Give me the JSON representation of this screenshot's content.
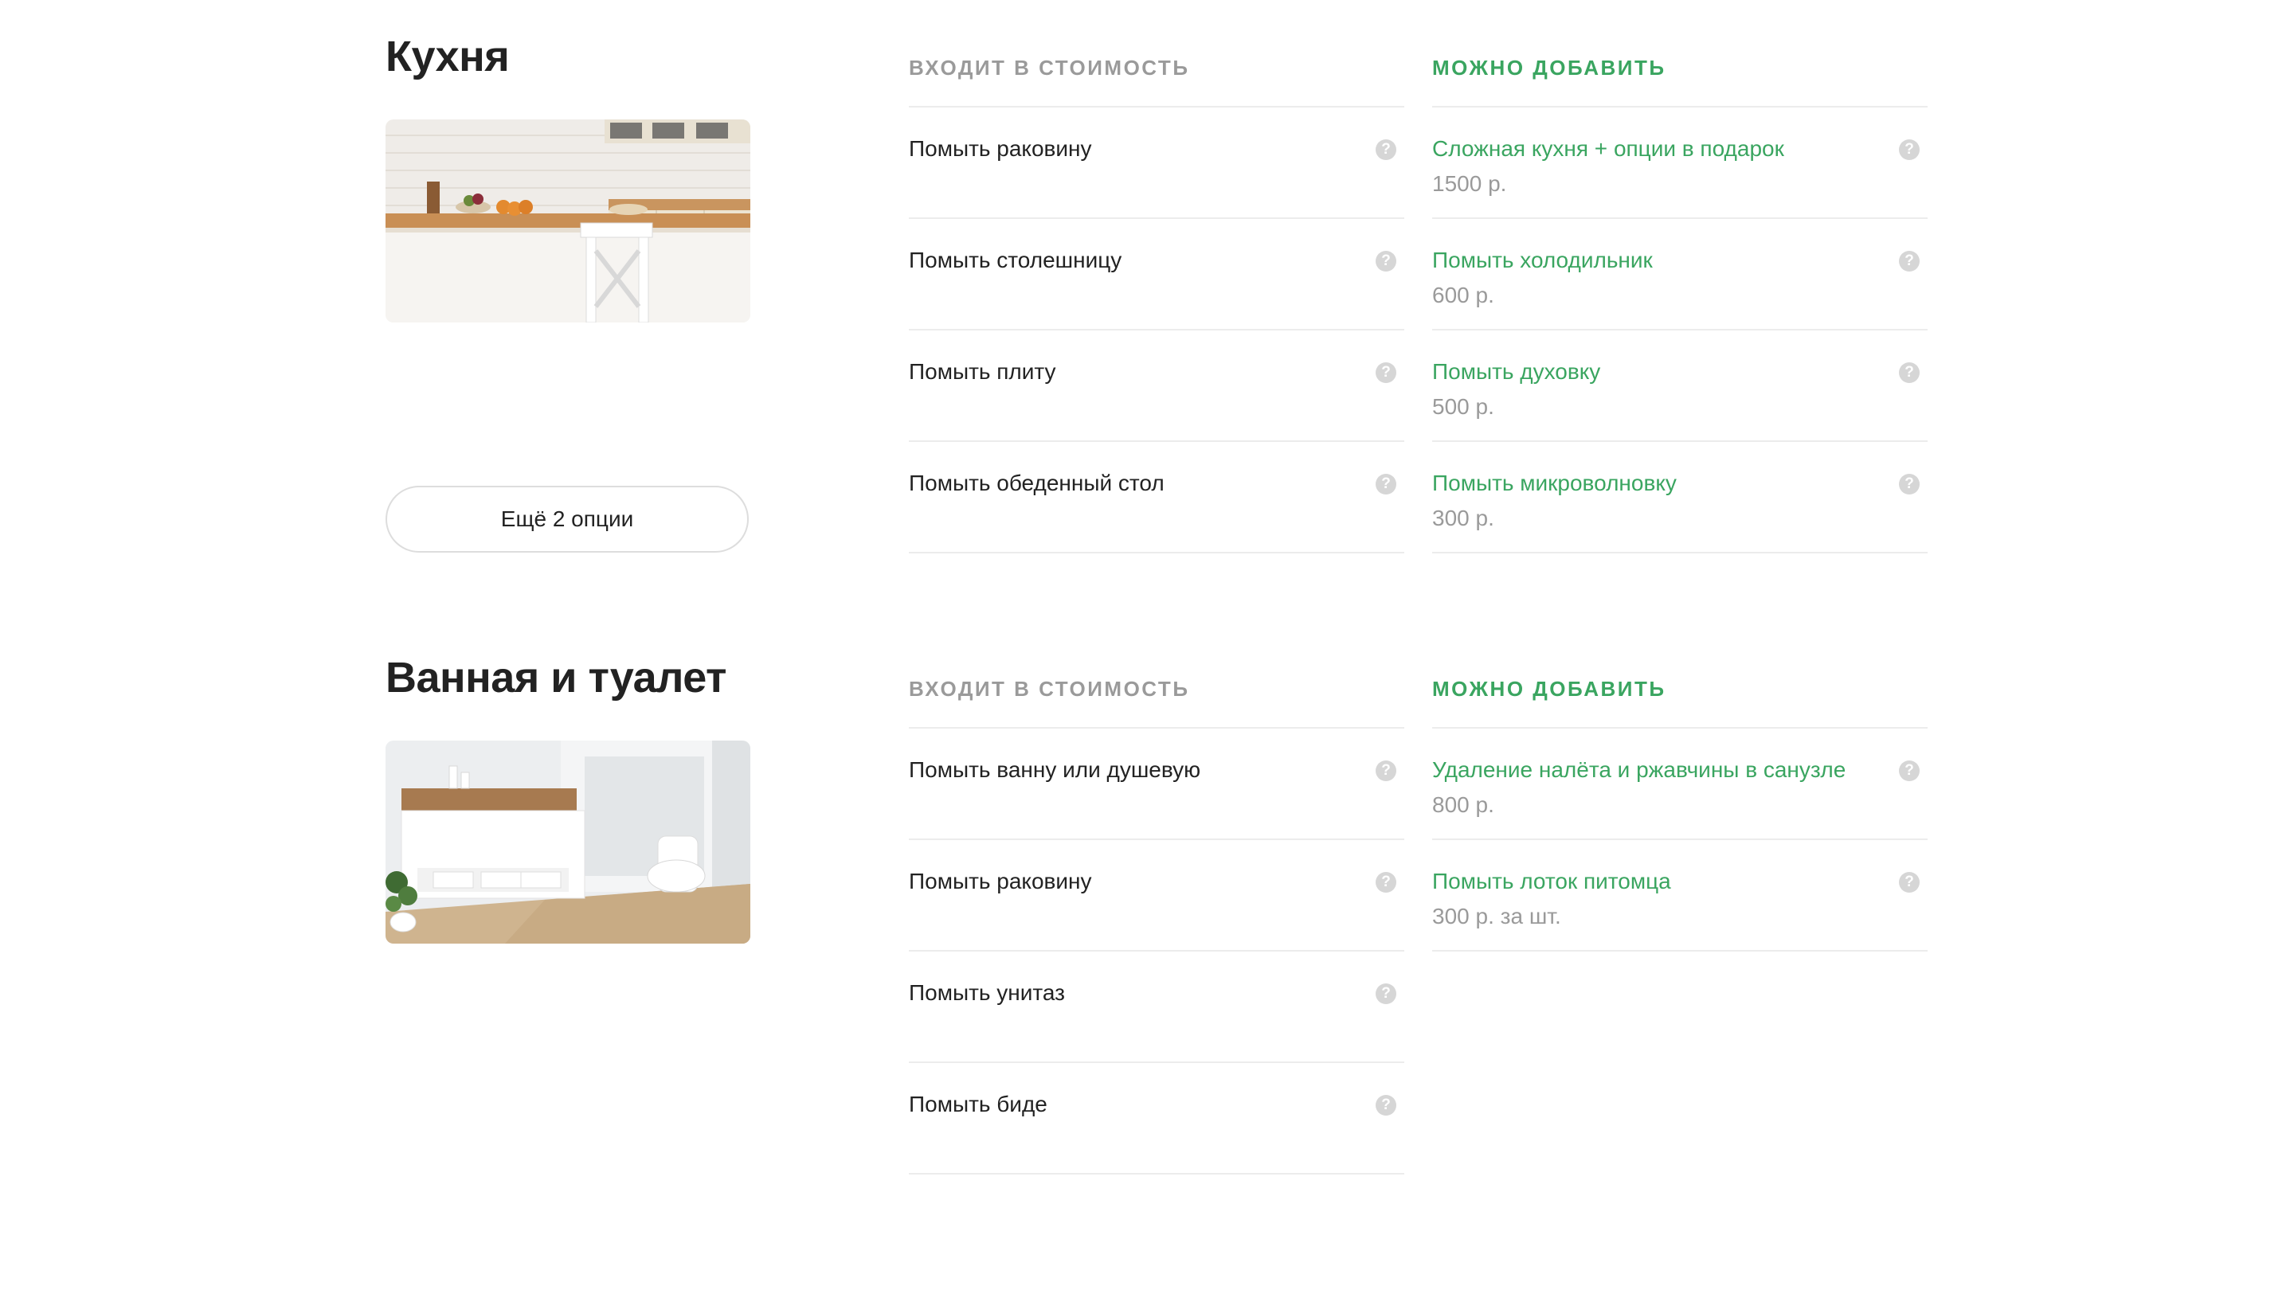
{
  "sections": [
    {
      "title": "Кухня",
      "image_icon": "kitchen-photo",
      "more_button": "Ещё 2 опции",
      "included_header": "Входит в стоимость",
      "addons_header": "Можно добавить",
      "included": [
        {
          "name": "Помыть раковину",
          "help": "?"
        },
        {
          "name": "Помыть столешницу",
          "help": "?"
        },
        {
          "name": "Помыть плиту",
          "help": "?"
        },
        {
          "name": "Помыть обеденный стол",
          "help": "?"
        }
      ],
      "addons": [
        {
          "name": "Сложная кухня + опции в подарок",
          "price": "1500 р.",
          "help": "?"
        },
        {
          "name": "Помыть холодильник",
          "price": "600 р.",
          "help": "?"
        },
        {
          "name": "Помыть духовку",
          "price": "500 р.",
          "help": "?"
        },
        {
          "name": "Помыть микроволновку",
          "price": "300 р.",
          "help": "?"
        }
      ]
    },
    {
      "title": "Ванная и туалет",
      "image_icon": "bathroom-photo",
      "included_header": "Входит в стоимость",
      "addons_header": "Можно добавить",
      "included": [
        {
          "name": "Помыть ванну или душевую",
          "help": "?"
        },
        {
          "name": "Помыть раковину",
          "help": "?"
        },
        {
          "name": "Помыть унитаз",
          "help": "?"
        },
        {
          "name": "Помыть биде",
          "help": "?"
        }
      ],
      "addons": [
        {
          "name": "Удаление налёта и ржавчины в санузле",
          "price": "800 р.",
          "help": "?"
        },
        {
          "name": "Помыть лоток питомца",
          "price": "300 р. за шт.",
          "help": "?"
        }
      ]
    }
  ],
  "colors": {
    "accent_green": "#3aa560",
    "muted_gray": "#9a9a9a",
    "text_dark": "#222222",
    "divider": "#ececec",
    "help_icon_bg": "#d6d6d6"
  }
}
